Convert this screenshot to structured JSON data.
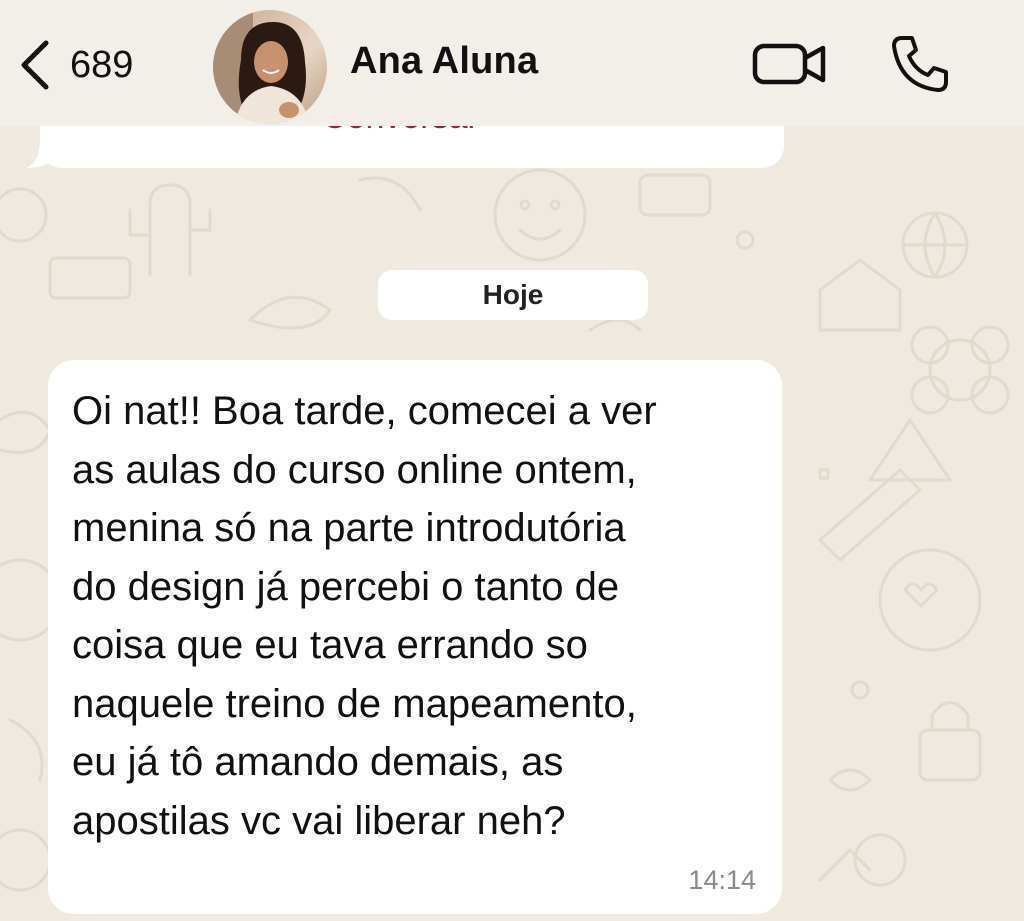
{
  "header": {
    "back_count": "689",
    "contact_name": "Ana Aluna",
    "back_icon": "chevron-left-icon",
    "video_icon": "video-camera-icon",
    "call_icon": "phone-icon"
  },
  "chat": {
    "previous_message_partial": "Conversar",
    "date_separator": "Hoje",
    "messages": [
      {
        "text": "Oi nat!! Boa tarde, comecei a ver\nas aulas do curso online ontem,\nmenina só na parte introdutória\ndo design já percebi o tanto de\ncoisa que eu tava errando so\nnaquele treino de mapeamento,\neu já tô amando demais, as\napostilas vc vai liberar neh?",
        "time": "14:14"
      }
    ]
  },
  "colors": {
    "header_bg": "#f2efe9",
    "wallpaper_bg": "#efe9df",
    "bubble_bg": "#ffffff",
    "link_color": "#9a2340",
    "timestamp_color": "#8a8a8a"
  }
}
